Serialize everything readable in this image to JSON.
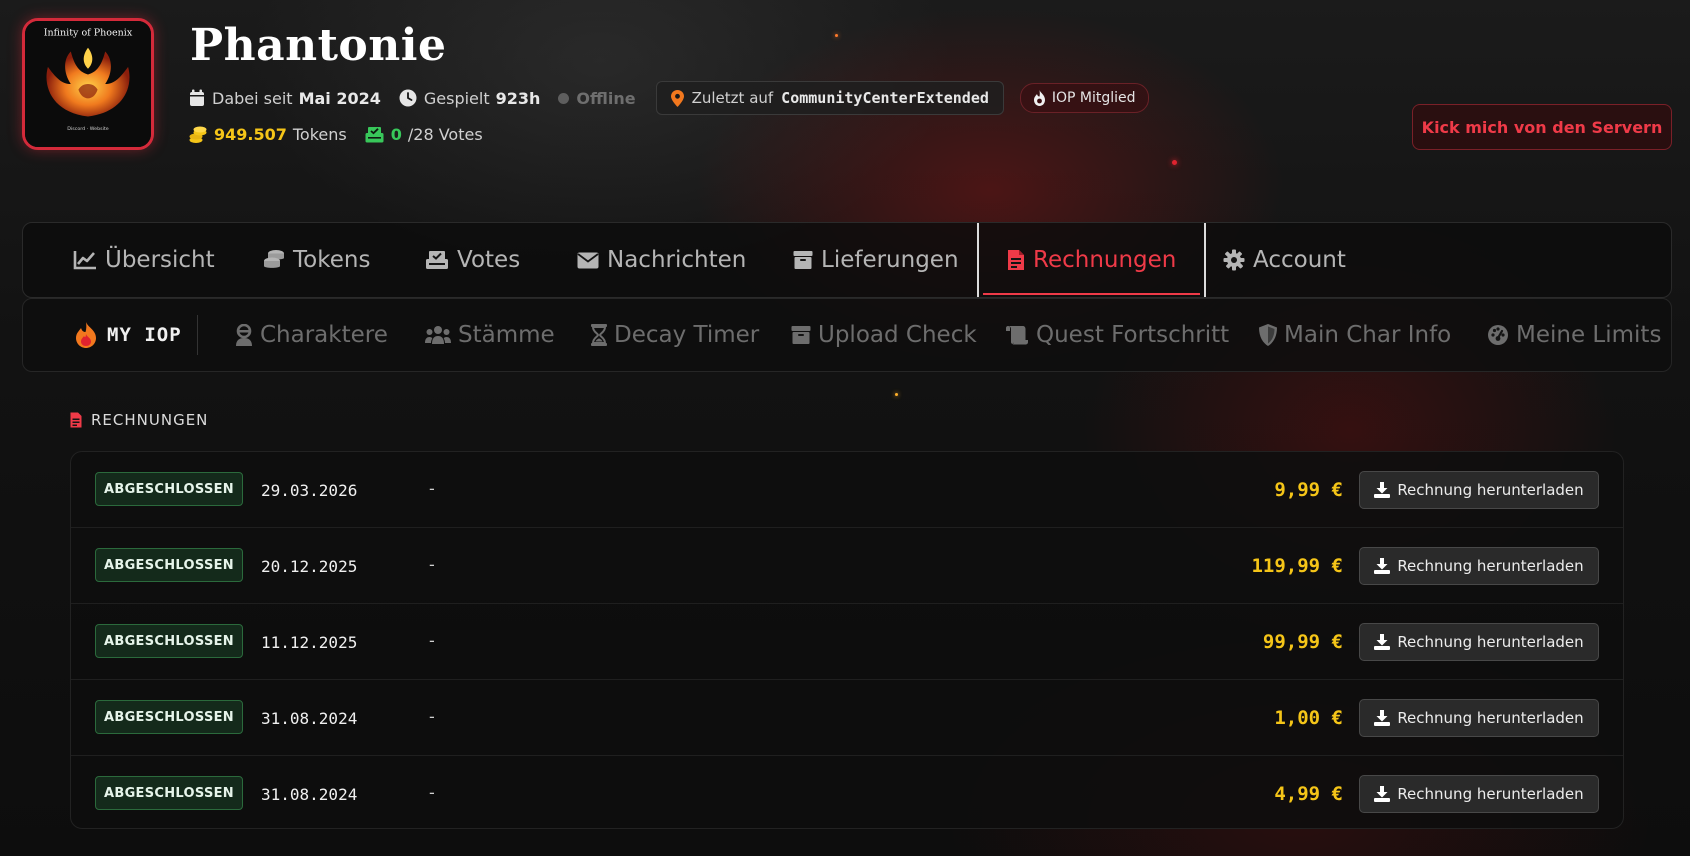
{
  "profile": {
    "logo_text_top": "Infinity of Phoenix",
    "logo_text_bottom": "Discord: Discord.gg/Phoenix · Website: infinity-of-phoenix-asa.com",
    "username": "Phantonie",
    "member_since_label": "Dabei seit",
    "member_since_value": "Mai 2024",
    "played_label": "Gespielt",
    "played_value": "923h",
    "status": "Offline",
    "last_seen_label": "Zuletzt auf",
    "last_seen_server": "CommunityCenterExtended",
    "membership_badge": "IOP Mitglied",
    "tokens_value": "949.507",
    "tokens_label": "Tokens",
    "votes_value": "0",
    "votes_suffix": "/28 Votes"
  },
  "kick_button": "Kick mich von den Servern",
  "main_tabs": [
    {
      "label": "Übersicht",
      "icon": "chart-line-icon"
    },
    {
      "label": "Tokens",
      "icon": "coins-icon"
    },
    {
      "label": "Votes",
      "icon": "vote-box-icon"
    },
    {
      "label": "Nachrichten",
      "icon": "envelope-icon"
    },
    {
      "label": "Lieferungen",
      "icon": "box-icon"
    },
    {
      "label": "Rechnungen",
      "icon": "invoice-icon",
      "active": true
    },
    {
      "label": "Account",
      "icon": "gear-icon"
    }
  ],
  "sub_tabs": {
    "brand": "MY IOP",
    "items": [
      {
        "label": "Charaktere",
        "icon": "character-icon"
      },
      {
        "label": "Stämme",
        "icon": "tribe-icon"
      },
      {
        "label": "Decay Timer",
        "icon": "hourglass-icon"
      },
      {
        "label": "Upload Check",
        "icon": "archive-icon"
      },
      {
        "label": "Quest Fortschritt",
        "icon": "scroll-icon"
      },
      {
        "label": "Main Char Info",
        "icon": "shield-icon"
      },
      {
        "label": "Meine Limits",
        "icon": "gauge-icon"
      }
    ]
  },
  "section": {
    "title": "RECHNUNGEN"
  },
  "invoices": [
    {
      "status": "ABGESCHLOSSEN",
      "date": "29.03.2026",
      "note": "-",
      "amount": "9,99 €",
      "download_label": "Rechnung herunterladen"
    },
    {
      "status": "ABGESCHLOSSEN",
      "date": "20.12.2025",
      "note": "-",
      "amount": "119,99 €",
      "download_label": "Rechnung herunterladen"
    },
    {
      "status": "ABGESCHLOSSEN",
      "date": "11.12.2025",
      "note": "-",
      "amount": "99,99 €",
      "download_label": "Rechnung herunterladen"
    },
    {
      "status": "ABGESCHLOSSEN",
      "date": "31.08.2024",
      "note": "-",
      "amount": "1,00 €",
      "download_label": "Rechnung herunterladen"
    },
    {
      "status": "ABGESCHLOSSEN",
      "date": "31.08.2024",
      "note": "-",
      "amount": "4,99 €",
      "download_label": "Rechnung herunterladen"
    }
  ],
  "colors": {
    "accent_red": "#ef3a48",
    "token_gold": "#f5c518",
    "vote_green": "#38c75a",
    "badge_green_bg": "#142a1b"
  }
}
